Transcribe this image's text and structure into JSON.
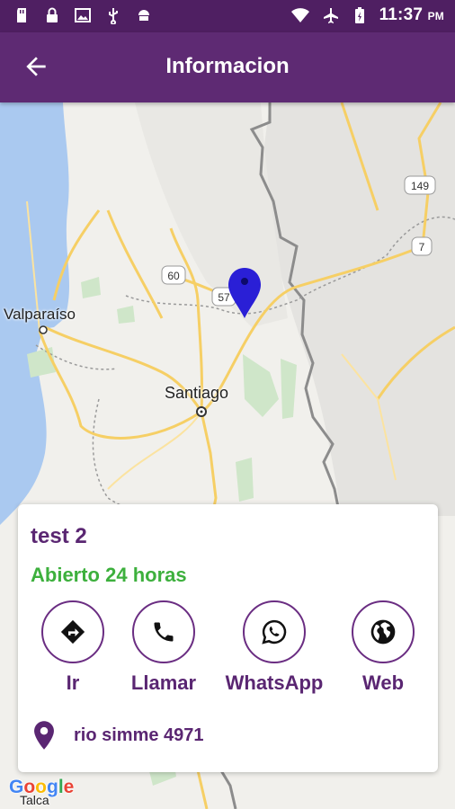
{
  "status_bar": {
    "time": "11:37",
    "ampm": "PM"
  },
  "app_bar": {
    "title": "Informacion"
  },
  "map": {
    "labels": {
      "valparaiso": "Valparaíso",
      "santiago": "Santiago",
      "talca": "Talca"
    },
    "shields": {
      "r60": "60",
      "r57": "57",
      "r149": "149",
      "r7": "7"
    },
    "attribution": "Google"
  },
  "place": {
    "name": "test 2",
    "status": "Abierto 24 horas",
    "status_color": "#3db03d",
    "address": "rio simme 4971"
  },
  "actions": [
    {
      "label": "Ir",
      "icon": "directions-icon"
    },
    {
      "label": "Llamar",
      "icon": "phone-icon"
    },
    {
      "label": "WhatsApp",
      "icon": "whatsapp-icon"
    },
    {
      "label": "Web",
      "icon": "globe-icon"
    }
  ],
  "colors": {
    "primary": "#5e2a73",
    "status_bar": "#4f1f62",
    "accent_text": "#5a2672",
    "marker": "#2a1fd6"
  }
}
